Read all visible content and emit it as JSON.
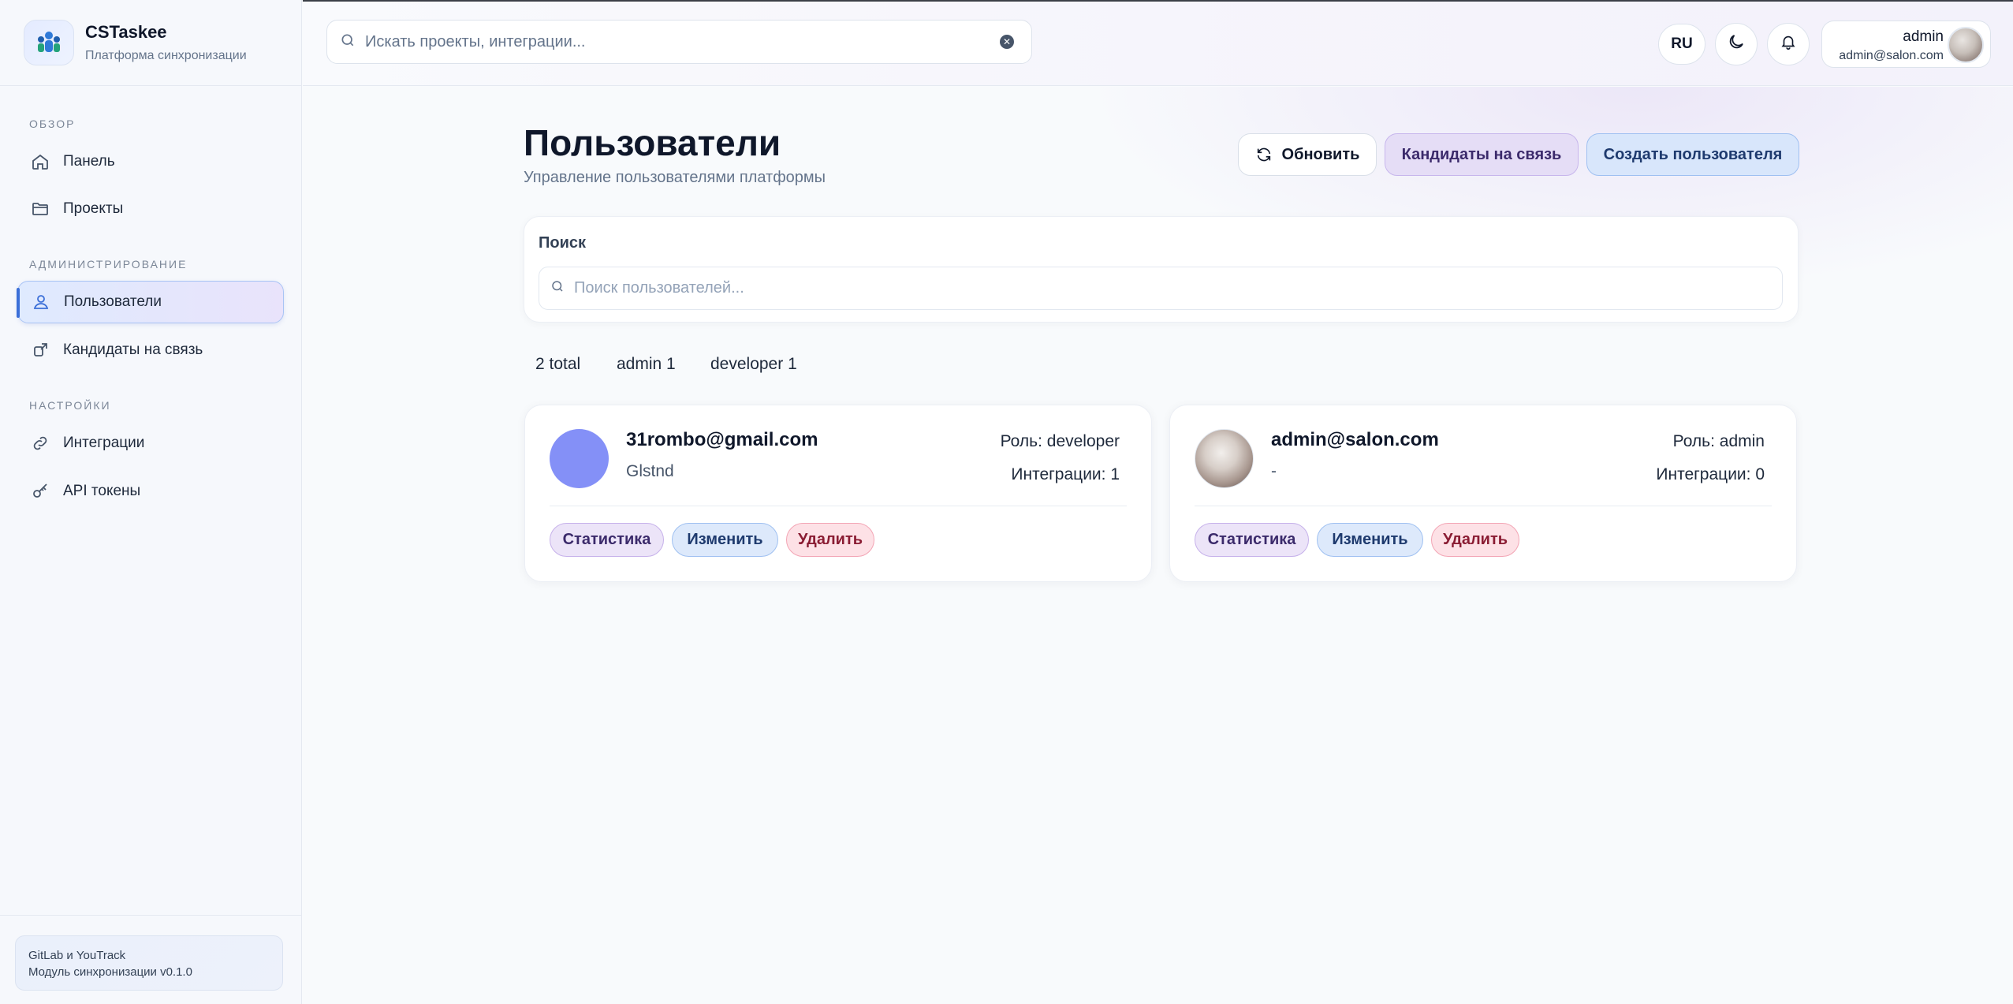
{
  "brand": {
    "name": "CSTaskee",
    "subtitle": "Платформа синхронизации"
  },
  "sidebar": {
    "sections": [
      {
        "title": "ОБЗОР"
      },
      {
        "title": "АДМИНИСТРИРОВАНИЕ"
      },
      {
        "title": "НАСТРОЙКИ"
      }
    ],
    "items": [
      {
        "label": "Панель",
        "icon": "home-icon"
      },
      {
        "label": "Проекты",
        "icon": "folder-icon"
      },
      {
        "label": "Пользователи",
        "icon": "user-icon",
        "active": true
      },
      {
        "label": "Кандидаты на связь",
        "icon": "link-candidate-icon"
      },
      {
        "label": "Интеграции",
        "icon": "link-icon"
      },
      {
        "label": "API токены",
        "icon": "key-icon"
      }
    ],
    "footer": {
      "line1": "GitLab и YouTrack",
      "line2": "Модуль синхронизации v0.1.0"
    }
  },
  "header": {
    "search_placeholder": "Искать проекты, интеграции...",
    "lang": "RU",
    "user": {
      "name": "admin",
      "email": "admin@salon.com"
    }
  },
  "page": {
    "title": "Пользователи",
    "subtitle": "Управление пользователями платформы",
    "buttons": {
      "refresh": "Обновить",
      "candidates": "Кандидаты на связь",
      "create": "Создать пользователя"
    },
    "search": {
      "label": "Поиск",
      "placeholder": "Поиск пользователей..."
    },
    "stats": {
      "total": "2 total",
      "admin": "admin 1",
      "developer": "developer 1"
    },
    "users": [
      {
        "email": "31rombo@gmail.com",
        "name": "Glstnd",
        "role": "Роль: developer",
        "integrations": "Интеграции: 1",
        "avatar": "solid",
        "avatar_color": "#8490f7"
      },
      {
        "email": "admin@salon.com",
        "name": "-",
        "role": "Роль: admin",
        "integrations": "Интеграции: 0",
        "avatar": "photo-cat"
      }
    ],
    "card_actions": {
      "stats": "Статистика",
      "edit": "Изменить",
      "delete": "Удалить"
    }
  },
  "colors": {
    "accent_blue": "#3b6fd8",
    "purple_button": "#e5ddf6",
    "blue_button": "#d8e6fb",
    "delete_pill": "#fde1e6"
  }
}
